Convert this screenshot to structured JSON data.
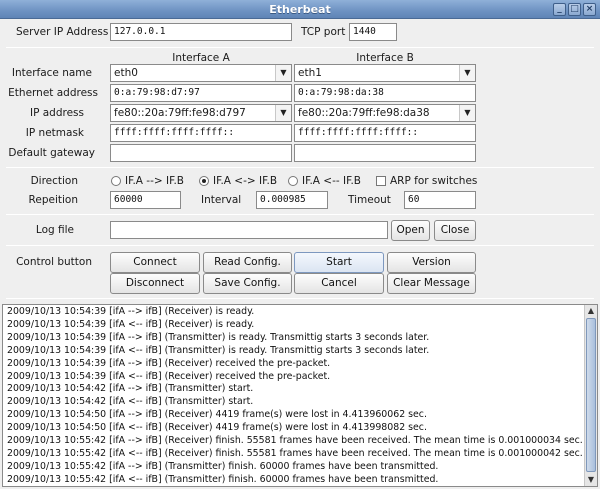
{
  "window": {
    "title": "Etherbeat"
  },
  "server": {
    "ip_label": "Server IP Address",
    "ip_value": "127.0.0.1",
    "port_label": "TCP port",
    "port_value": "1440"
  },
  "interfaces": {
    "col_a": "Interface A",
    "col_b": "Interface B",
    "rows": [
      {
        "label": "Interface name",
        "a": "eth0",
        "b": "eth1"
      },
      {
        "label": "Ethernet address",
        "a": "0:a:79:98:d7:97",
        "b": "0:a:79:98:da:38"
      },
      {
        "label": "IP address",
        "a": "fe80::20a:79ff:fe98:d797",
        "b": "fe80::20a:79ff:fe98:da38"
      },
      {
        "label": "IP netmask",
        "a": "ffff:ffff:ffff:ffff::",
        "b": "ffff:ffff:ffff:ffff::"
      },
      {
        "label": "Default gateway",
        "a": "",
        "b": ""
      }
    ]
  },
  "direction": {
    "label": "Direction",
    "options": [
      "IF.A --> IF.B",
      "IF.A <-> IF.B",
      "IF.A <-- IF.B"
    ],
    "selected": 1,
    "arp_label": "ARP for switches",
    "arp_checked": false
  },
  "repetition": {
    "label": "Repeition",
    "value": "60000",
    "interval_label": "Interval",
    "interval_value": "0.000985",
    "timeout_label": "Timeout",
    "timeout_value": "60"
  },
  "logfile": {
    "label": "Log file",
    "value": "",
    "open": "Open",
    "close": "Close"
  },
  "control": {
    "label": "Control button",
    "buttons": [
      [
        "Connect",
        "Read Config.",
        "Start",
        "Version"
      ],
      [
        "Disconnect",
        "Save Config.",
        "Cancel",
        "Clear Message"
      ]
    ]
  },
  "log": [
    "2009/10/13 10:54:39 [ifA --> ifB] (Receiver) is ready.",
    "2009/10/13 10:54:39 [ifA <-- ifB] (Receiver) is ready.",
    "2009/10/13 10:54:39 [ifA --> ifB] (Transmitter) is ready. Transmittig starts 3 seconds later.",
    "2009/10/13 10:54:39 [ifA <-- ifB] (Transmitter) is ready. Transmittig starts 3 seconds later.",
    "2009/10/13 10:54:39 [ifA --> ifB] (Receiver) received the pre-packet.",
    "2009/10/13 10:54:39 [ifA <-- ifB] (Receiver) received the pre-packet.",
    "2009/10/13 10:54:42 [ifA --> ifB] (Transmitter) start.",
    "2009/10/13 10:54:42 [ifA <-- ifB] (Transmitter) start.",
    "2009/10/13 10:54:50 [ifA --> ifB] (Receiver) 4419 frame(s) were lost in 4.413960062 sec.",
    "2009/10/13 10:54:50 [ifA <-- ifB] (Receiver) 4419 frame(s) were lost in 4.413998082 sec.",
    "2009/10/13 10:55:42 [ifA --> ifB] (Receiver) finish. 55581 frames have been received. The mean time is 0.001000034 sec.",
    "2009/10/13 10:55:42 [ifA <-- ifB] (Receiver) finish. 55581 frames have been received. The mean time is 0.001000042 sec.",
    "2009/10/13 10:55:42 [ifA --> ifB] (Transmitter) finish. 60000 frames have been transmitted.",
    "2009/10/13 10:55:42 [ifA <-- ifB] (Transmitter) finish. 60000 frames have been transmitted."
  ]
}
